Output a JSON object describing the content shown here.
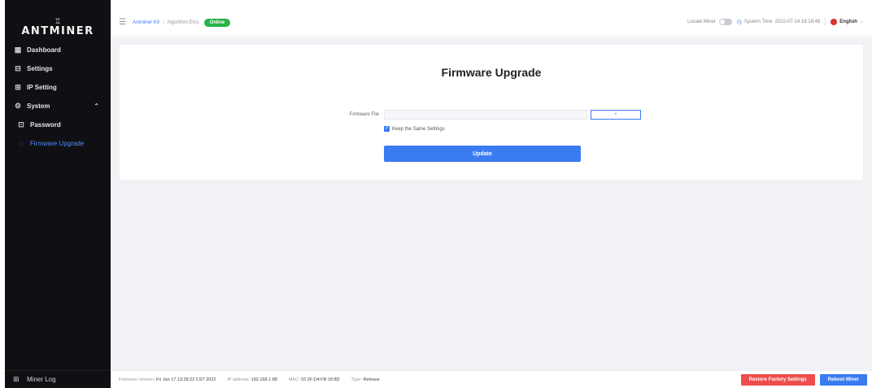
{
  "brand": {
    "logo_text": "ANTMINER"
  },
  "sidebar": {
    "items": [
      {
        "label": "Dashboard",
        "icon": "dashboard-icon"
      },
      {
        "label": "Settings",
        "icon": "settings-icon"
      },
      {
        "label": "IP Setting",
        "icon": "ip-setting-icon"
      },
      {
        "label": "System",
        "icon": "gear-icon"
      },
      {
        "label": "Password",
        "icon": "lock-icon"
      },
      {
        "label": "Firmware Upgrade",
        "icon": "upgrade-icon"
      }
    ],
    "miner_log": "Miner Log"
  },
  "header": {
    "model": "Antminer K9",
    "hashboard": "Algorithm:Eh/s",
    "status": "Online",
    "locate_label": "Locate Miner",
    "time_label": "System Time",
    "time_value": "2022-07-14 18:18:48",
    "language": "English"
  },
  "main": {
    "title": "Firmware Upgrade",
    "file_label": "Firmware File",
    "file_button": "+",
    "keep_settings_label": "Keep the Same Settings",
    "update_button": "Update"
  },
  "footer": {
    "firmware_label": "Firmware Version:",
    "firmware_value": "Fri Jan 17 13:28:22 CST 2022",
    "ip_label": "IP address:",
    "ip_value": "192.168.1.88",
    "mac_label": "MAC:",
    "mac_value": "02:2F:D4:FB:18:8D",
    "type_label": "Type:",
    "type_value": "Release",
    "restore_button": "Restore Factory Settings",
    "reboot_button": "Reboot Miner"
  },
  "colors": {
    "accent": "#3a7bf0",
    "success": "#27b24a",
    "danger": "#ee4d4d",
    "sidebar_bg": "#101014"
  }
}
